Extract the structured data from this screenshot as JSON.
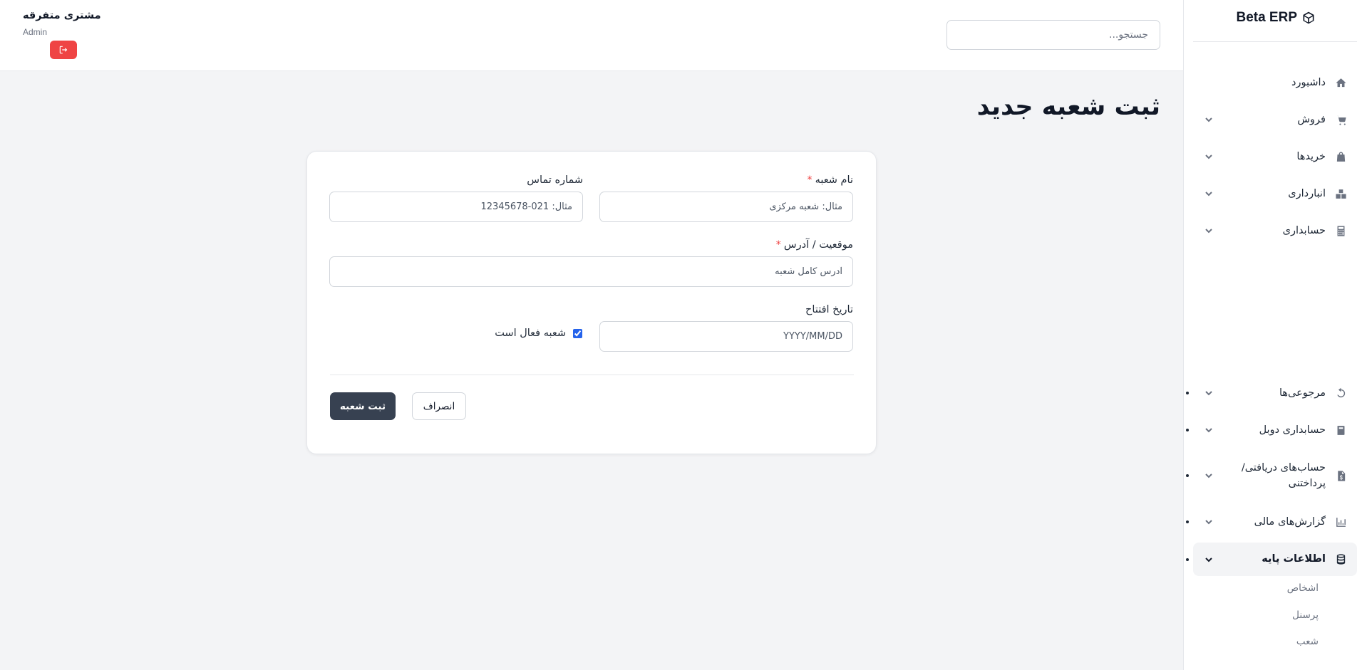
{
  "sidebar": {
    "brand": "Beta ERP",
    "items": [
      {
        "label": "داشبورد",
        "icon": "home-icon",
        "has_chevron": false
      },
      {
        "label": "فروش",
        "icon": "cart-icon",
        "has_chevron": true
      },
      {
        "label": "خریدها",
        "icon": "bag-icon",
        "has_chevron": true
      },
      {
        "label": "انبارداری",
        "icon": "boxes-icon",
        "has_chevron": true
      },
      {
        "label": "حسابداری",
        "icon": "calculator-icon",
        "has_chevron": true
      },
      {
        "label": "مرجوعی‌ها",
        "icon": "undo-icon",
        "has_chevron": true
      },
      {
        "label": "حسابداری دوبل",
        "icon": "book-icon",
        "has_chevron": true
      },
      {
        "label": "حساب‌های دریافتی/ پرداختنی",
        "icon": "invoice-icon",
        "has_chevron": true
      },
      {
        "label": "گزارش‌های مالی",
        "icon": "chart-icon",
        "has_chevron": true
      },
      {
        "label": "اطلاعات پایه",
        "icon": "database-icon",
        "has_chevron": true,
        "active": true
      }
    ],
    "sub_items": [
      "اشخاص",
      "پرسنل",
      "شعب"
    ]
  },
  "header": {
    "search_placeholder": "جستجو...",
    "user_name": "مشتری متفرقه",
    "user_role": "Admin",
    "logout_icon": "logout-icon",
    "logout_color": "#ef4444"
  },
  "page": {
    "title": "ثبت شعبه جدید"
  },
  "form": {
    "branch_name": {
      "label": "نام شعبه",
      "required_mark": "*",
      "placeholder": "مثال: شعبه مرکزی",
      "value": ""
    },
    "phone": {
      "label": "شماره تماس",
      "placeholder": "مثال: 021-12345678",
      "value": ""
    },
    "address": {
      "label": "موقعیت / آدرس",
      "required_mark": "*",
      "placeholder": "آدرس کامل شعبه",
      "value": ""
    },
    "opening_date": {
      "label": "تاریخ افتتاح",
      "placeholder": "YYYY/MM/DD",
      "value": ""
    },
    "active": {
      "label": "شعبه فعال است",
      "checked": true
    },
    "submit_label": "ثبت شعبه",
    "cancel_label": "انصراف"
  },
  "colors": {
    "primary_button": "#374151",
    "accent": "#2563eb",
    "danger": "#ef4444"
  }
}
